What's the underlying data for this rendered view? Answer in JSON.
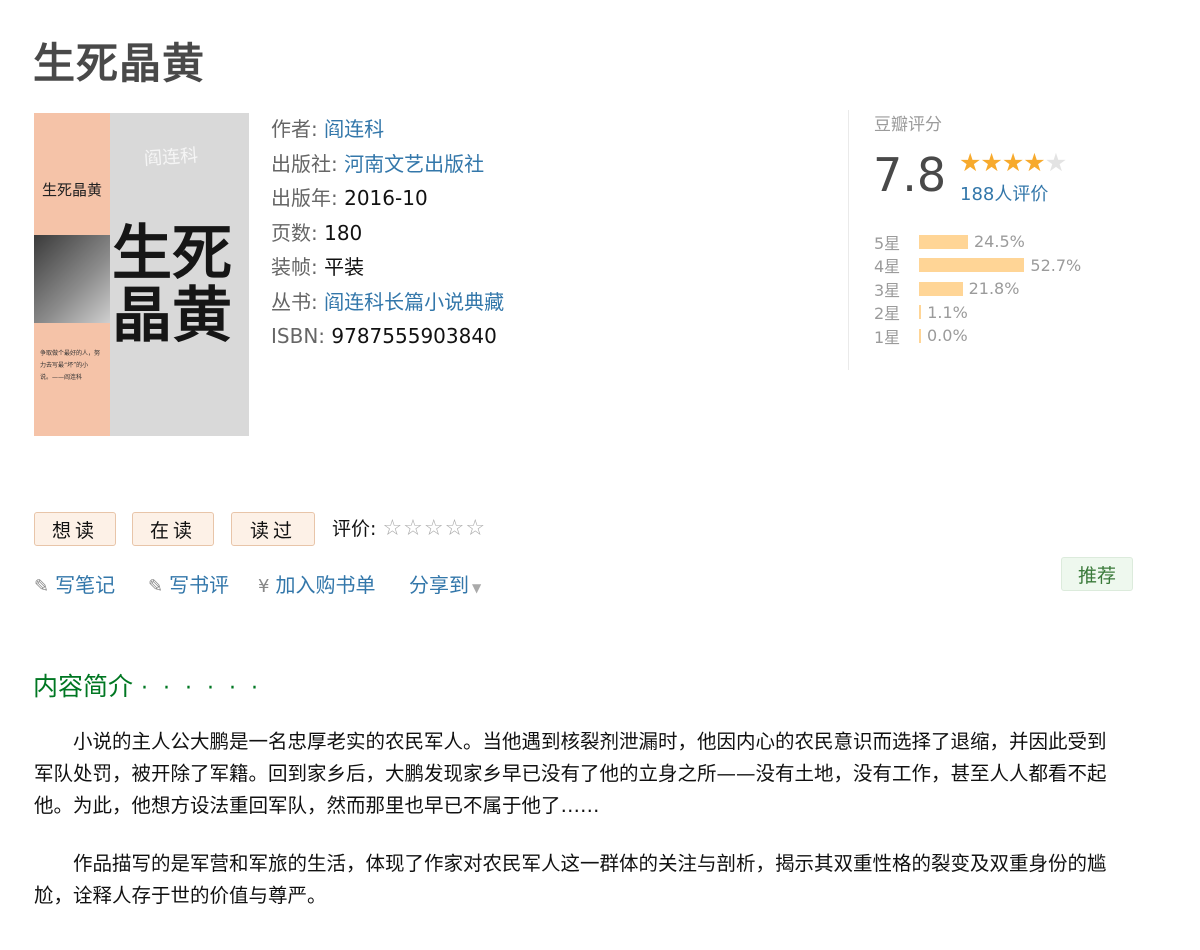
{
  "book": {
    "title": "生死晶黄",
    "cover": {
      "title": "生死晶黄",
      "big_chars": "生死晶黄",
      "author_sig": "阎连科",
      "quote": "争取做个最好的人，努力去写最“坏”的小说。——阎连科"
    },
    "info": {
      "author_label": "作者:",
      "author": "阎连科",
      "publisher_label": "出版社:",
      "publisher": "河南文艺出版社",
      "year_label": "出版年:",
      "year": "2016-10",
      "pages_label": "页数:",
      "pages": "180",
      "binding_label": "装帧:",
      "binding": "平装",
      "series_label": "丛书:",
      "series": "阎连科长篇小说典藏",
      "isbn_label": "ISBN:",
      "isbn": "9787555903840"
    }
  },
  "rating": {
    "title": "豆瓣评分",
    "score": "7.8",
    "stars_filled": 4,
    "count": "188人评价",
    "rows": [
      {
        "label": "5星",
        "pct": "24.5%",
        "value": 24.5
      },
      {
        "label": "4星",
        "pct": "52.7%",
        "value": 52.7
      },
      {
        "label": "3星",
        "pct": "21.8%",
        "value": 21.8
      },
      {
        "label": "2星",
        "pct": "1.1%",
        "value": 1.1
      },
      {
        "label": "1星",
        "pct": "0.0%",
        "value": 0.0
      }
    ]
  },
  "actions": {
    "want": "想读",
    "reading": "在读",
    "read": "读过",
    "rate_label": "评价:",
    "write_note": "写笔记",
    "write_review": "写书评",
    "add_booklist": "加入购书单",
    "share": "分享到",
    "recommend": "推荐"
  },
  "intro": {
    "heading": "内容简介",
    "dots": "· · · · · ·",
    "p1": "小说的主人公大鹏是一名忠厚老实的农民军人。当他遇到核裂剂泄漏时，他因内心的农民意识而选择了退缩，并因此受到军队处罚，被开除了军籍。回到家乡后，大鹏发现家乡早已没有了他的立身之所——没有土地，没有工作，甚至人人都看不起他。为此，他想方设法重回军队，然而那里也早已不属于他了……",
    "p2": "作品描写的是军营和军旅的生活，体现了作家对农民军人这一群体的关注与剖析，揭示其双重性格的裂变及双重身份的尴尬，诠释人存于世的价值与尊严。"
  }
}
